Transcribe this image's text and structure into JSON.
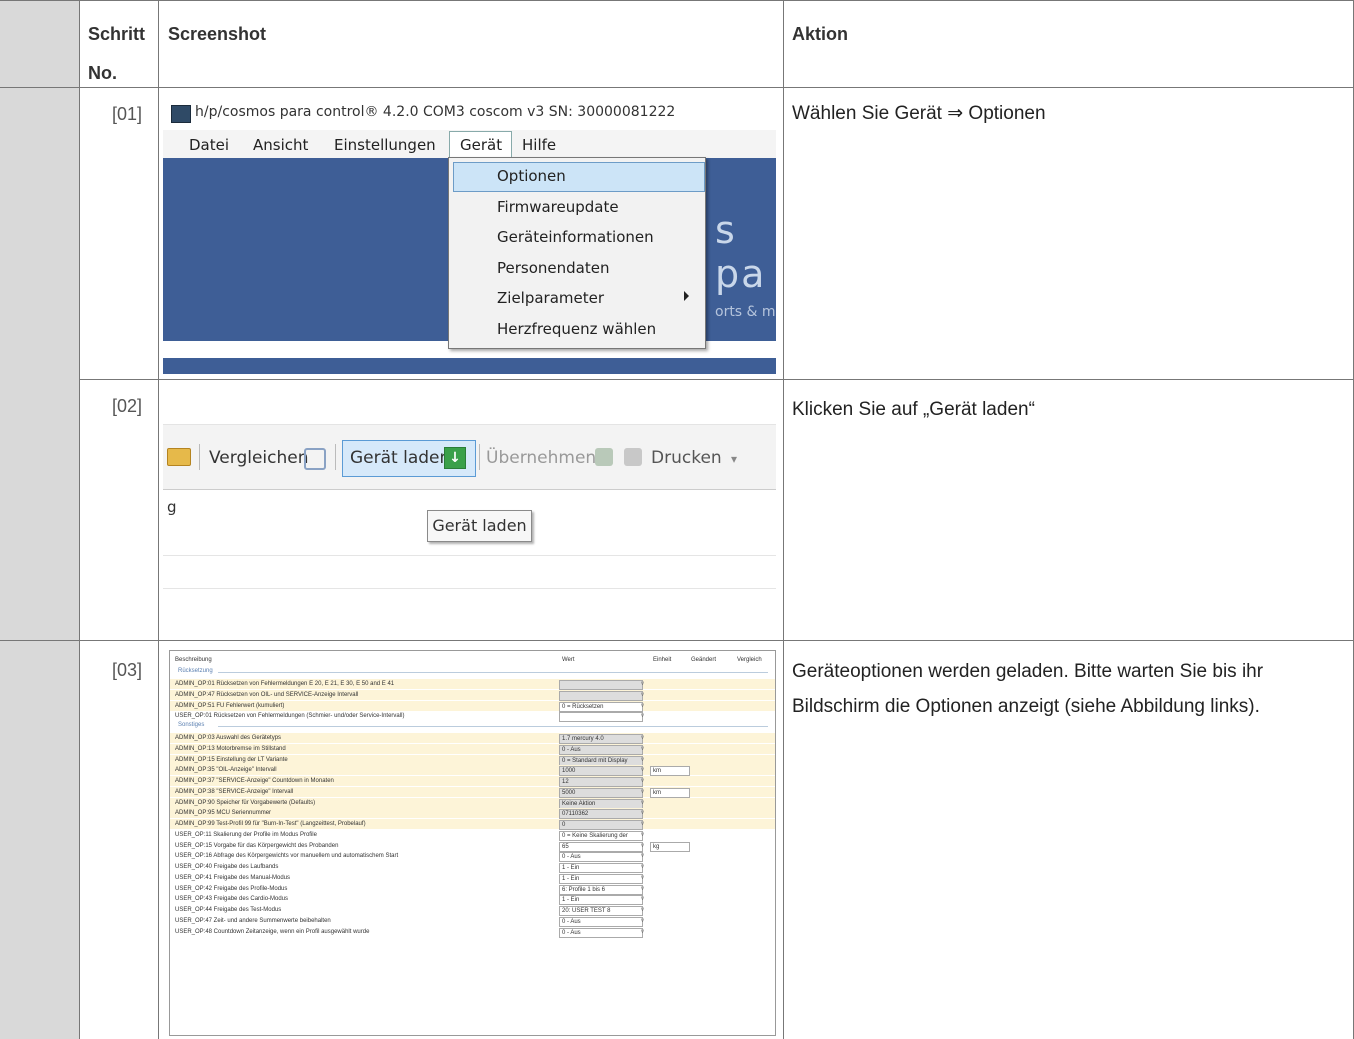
{
  "headers": {
    "step": "Schritt",
    "step2": "No.",
    "screenshot": "Screenshot",
    "action": "Aktion"
  },
  "rows": [
    {
      "no": "[01]",
      "action": "Wählen Sie Gerät ⇒ Optionen"
    },
    {
      "no": "[02]",
      "action": "Klicken Sie auf „Gerät laden“"
    },
    {
      "no": "[03]",
      "action": "Geräteoptionen werden geladen. Bitte warten Sie bis ihr Bildschirm die Optionen anzeigt (siehe Abbildung links)."
    }
  ],
  "shot1": {
    "title": "h/p/cosmos para control® 4.2.0 COM3 coscom v3  SN: 30000081222",
    "menu": [
      "Datei",
      "Ansicht",
      "Einstellungen",
      "Gerät",
      "Hilfe"
    ],
    "dropdown": [
      "Optionen",
      "Firmwareupdate",
      "Geräteinformationen",
      "Personendaten",
      "Zielparameter",
      "Herzfrequenz wählen"
    ],
    "bg_text": "s pa",
    "bg_sub": "orts & m"
  },
  "shot2": {
    "toolbar": {
      "compare": "Vergleichen",
      "load": "Gerät laden",
      "apply": "Übernehmen",
      "print": "Drucken"
    },
    "row_text": "g",
    "tooltip": "Gerät laden"
  },
  "shot3": {
    "columns": {
      "desc": "Beschreibung",
      "value": "Wert",
      "unit": "Einheit",
      "changed": "Geändert",
      "compare": "Vergleich"
    },
    "sections": {
      "reset": "Rücksetzung",
      "misc": "Sonstiges"
    },
    "reset_rows": [
      {
        "d": "ADMIN_OP:01 Rücksetzen von Fehlermeldungen E 20, E 21, E 30, E 50 and E 41",
        "v": ""
      },
      {
        "d": "ADMIN_OP:47 Rücksetzen von OIL- und SERVICE-Anzeige Intervall",
        "v": ""
      },
      {
        "d": "ADMIN_OP:51 FU Fehlerwert (kumuliert)",
        "v": "0 = Rücksetzen"
      },
      {
        "d": "USER_OP:01 Rücksetzen von Fehlermeldungen (Schmier- und/oder Service-Intervall)",
        "v": ""
      }
    ],
    "misc_rows": [
      {
        "d": "ADMIN_OP:03 Auswahl des Gerätetyps",
        "v": "1.7 mercury 4.0"
      },
      {
        "d": "ADMIN_OP:13 Motorbremse im Stillstand",
        "v": "0 - Aus"
      },
      {
        "d": "ADMIN_OP:15 Einstellung der LT Variante",
        "v": "0 = Standard mit Display"
      },
      {
        "d": "ADMIN_OP:35 \"OIL-Anzeige\" Intervall",
        "v": "1000",
        "u": "km"
      },
      {
        "d": "ADMIN_OP:37 \"SERVICE-Anzeige\" Countdown in Monaten",
        "v": "12"
      },
      {
        "d": "ADMIN_OP:38 \"SERVICE-Anzeige\" Intervall",
        "v": "5000",
        "u": "km"
      },
      {
        "d": "ADMIN_OP:90 Speicher für Vorgabewerte (Defaults)",
        "v": "Keine Aktion"
      },
      {
        "d": "ADMIN_OP:95 MCU Seriennummer",
        "v": "07110362"
      },
      {
        "d": "ADMIN_OP:99 Test-Profil 99 für \"Burn-In-Test\" (Langzeittest, Probelauf)",
        "v": "0"
      },
      {
        "d": "USER_OP:11 Skalierung der Profile im Modus Profile",
        "v": "0 = Keine Skalierung der"
      },
      {
        "d": "USER_OP:15 Vorgabe für das Körpergewicht des Probanden",
        "v": "65",
        "u": "kg"
      },
      {
        "d": "USER_OP:16 Abfrage des Körpergewichts vor manuellem und automatischem Start",
        "v": "0 - Aus"
      },
      {
        "d": "USER_OP:40 Freigabe des Laufbands",
        "v": "1 - Ein"
      },
      {
        "d": "USER_OP:41 Freigabe des Manual-Modus",
        "v": "1 - Ein"
      },
      {
        "d": "USER_OP:42 Freigabe des Profile-Modus",
        "v": "6: Profile 1 bis 6"
      },
      {
        "d": "USER_OP:43 Freigabe des Cardio-Modus",
        "v": "1 - Ein"
      },
      {
        "d": "USER_OP:44 Freigabe des Test-Modus",
        "v": "20: USER TEST 8"
      },
      {
        "d": "USER_OP:47 Zeit- und andere Summenwerte beibehalten",
        "v": "0 - Aus"
      },
      {
        "d": "USER_OP:48 Countdown Zeitanzeige, wenn ein Profil ausgewählt wurde",
        "v": "0 - Aus"
      }
    ]
  }
}
